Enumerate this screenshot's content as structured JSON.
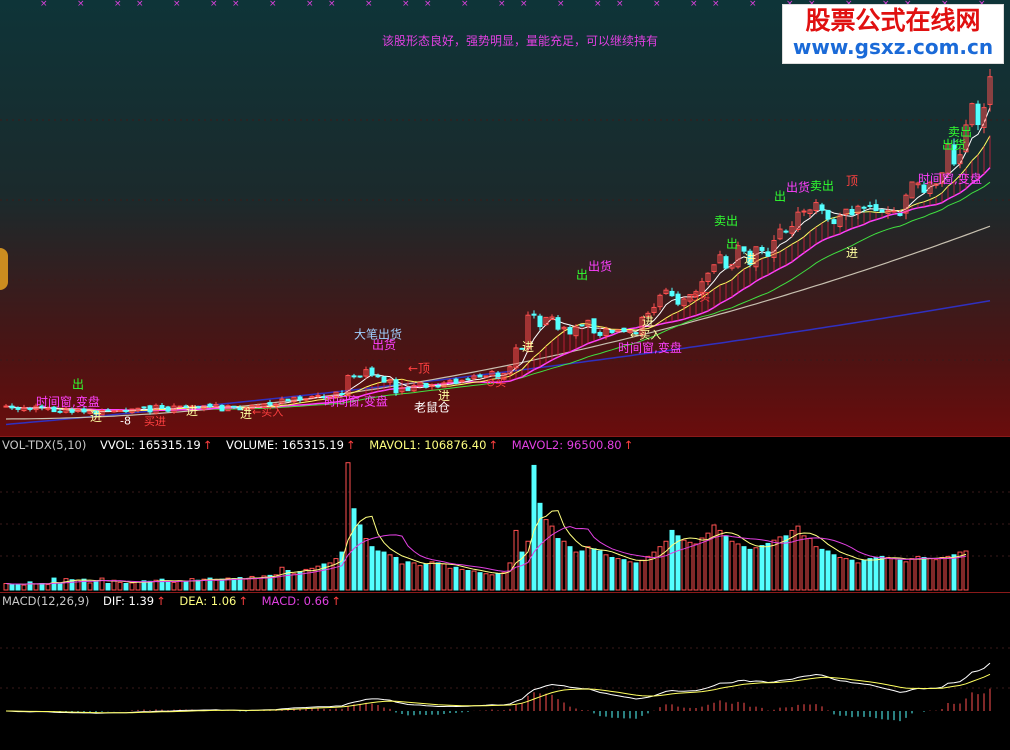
{
  "note": "该股形态良好，强势明显，量能充足，可以继续持有",
  "watermark": {
    "line1": "股票公式在线网",
    "line2": "www.gsxz.com.cn"
  },
  "volume_panel": {
    "indicator": "VOL-TDX(5,10)",
    "vvol": "VVOL: 165315.19",
    "volume": "VOLUME: 165315.19",
    "mavol1": "MAVOL1: 106876.40",
    "mavol2": "MAVOL2: 96500.80"
  },
  "macd_panel": {
    "indicator": "MACD(12,26,9)",
    "dif": "DIF: 1.39",
    "dea": "DEA: 1.06",
    "macd": "MACD: 0.66"
  },
  "colors": {
    "up": "#ff5050",
    "down": "#54ffff",
    "ma5": "#ffffff",
    "ma10": "#ffff60",
    "ma20": "#ff40ff",
    "ma30": "#40e040",
    "ma60": "#c8c0b0",
    "ma120": "#3030c0",
    "mavol2": "#e040e0"
  },
  "chart_data": [
    {
      "type": "candlestick",
      "x": [
        1,
        2,
        3,
        4,
        5,
        6,
        7,
        8,
        9,
        10,
        11,
        12,
        13,
        14,
        15,
        16,
        17,
        18,
        19,
        20,
        21,
        22,
        23,
        24,
        25,
        26,
        27,
        28,
        29,
        30,
        31,
        32,
        33,
        34,
        35,
        36,
        37,
        38,
        39,
        40,
        41,
        42,
        43,
        44,
        45,
        46,
        47,
        48,
        49,
        50,
        51,
        52,
        53,
        54,
        55,
        56,
        57,
        58,
        59,
        60,
        61,
        62,
        63,
        64,
        65,
        66,
        67,
        68,
        69,
        70,
        71,
        72,
        73,
        74,
        75,
        76,
        77,
        78,
        79,
        80,
        81,
        82,
        83,
        84,
        85,
        86,
        87,
        88,
        89,
        90,
        91,
        92,
        93,
        94,
        95,
        96,
        97,
        98,
        99,
        100,
        101,
        102,
        103,
        104,
        105,
        106,
        107,
        108,
        109,
        110,
        111,
        112,
        113,
        114,
        115,
        116,
        117,
        118,
        119,
        120,
        121,
        122,
        123,
        124,
        125,
        126,
        127,
        128,
        129,
        130,
        131,
        132,
        133,
        134,
        135,
        136,
        137,
        138,
        139,
        140,
        141,
        142,
        143,
        144,
        145,
        146,
        147,
        148,
        149,
        150,
        151,
        152,
        153,
        154,
        155,
        156,
        157,
        158,
        159,
        160,
        161
      ],
      "close": [
        5.55,
        5.5,
        5.46,
        5.51,
        5.46,
        5.55,
        5.52,
        5.49,
        5.4,
        5.39,
        5.47,
        5.38,
        5.46,
        5.39,
        5.41,
        5.33,
        5.43,
        5.44,
        5.42,
        5.43,
        5.4,
        5.47,
        5.49,
        5.52,
        5.39,
        5.57,
        5.49,
        5.41,
        5.55,
        5.55,
        5.52,
        5.55,
        5.5,
        5.56,
        5.54,
        5.59,
        5.42,
        5.56,
        5.53,
        5.45,
        5.49,
        5.57,
        5.56,
        5.61,
        5.59,
        5.6,
        5.74,
        5.69,
        5.79,
        5.72,
        5.75,
        5.81,
        5.84,
        5.78,
        5.81,
        5.93,
        5.88,
        6.38,
        6.35,
        6.35,
        6.54,
        6.39,
        6.35,
        6.2,
        6.27,
        5.91,
        6.05,
        5.97,
        6.11,
        6.19,
        6.06,
        6.13,
        6.09,
        6.18,
        6.25,
        6.17,
        6.25,
        6.27,
        6.37,
        6.34,
        6.37,
        6.49,
        6.3,
        6.44,
        6.62,
        7.13,
        7.1,
        8.02,
        8.02,
        7.71,
        7.96,
        7.97,
        7.64,
        7.69,
        7.51,
        7.7,
        7.73,
        7.88,
        7.54,
        7.47,
        7.65,
        7.55,
        7.62,
        7.58,
        7.6,
        7.54,
        7.96,
        8.07,
        8.23,
        8.56,
        8.7,
        8.55,
        8.32,
        8.46,
        8.58,
        8.66,
        8.93,
        9.16,
        9.39,
        9.66,
        9.3,
        9.4,
        9.91,
        9.76,
        9.4,
        9.88,
        9.78,
        9.62,
        10.05,
        10.36,
        10.3,
        10.43,
        10.82,
        10.85,
        10.88,
        11.08,
        10.87,
        10.63,
        10.51,
        10.72,
        10.9,
        10.75,
        10.98,
        10.93,
        10.99,
        10.86,
        10.82,
        10.86,
        10.85,
        10.73,
        11.28,
        11.64,
        11.61,
        11.36,
        11.63,
        11.59,
        11.89,
        12.67,
        12.13,
        12.38,
        13.19,
        13.77,
        13.2,
        13.66,
        14.5
      ]
    },
    {
      "type": "bar",
      "name": "VOLUME",
      "x": [
        1,
        2,
        3,
        4,
        5,
        6,
        7,
        8,
        9,
        10,
        11,
        12,
        13,
        14,
        15,
        16,
        17,
        18,
        19,
        20,
        21,
        22,
        23,
        24,
        25,
        26,
        27,
        28,
        29,
        30,
        31,
        32,
        33,
        34,
        35,
        36,
        37,
        38,
        39,
        40,
        41,
        42,
        43,
        44,
        45,
        46,
        47,
        48,
        49,
        50,
        51,
        52,
        53,
        54,
        55,
        56,
        57,
        58,
        59,
        60,
        61,
        62,
        63,
        64,
        65,
        66,
        67,
        68,
        69,
        70,
        71,
        72,
        73,
        74,
        75,
        76,
        77,
        78,
        79,
        80,
        81,
        82,
        83,
        84,
        85,
        86,
        87,
        88,
        89,
        90,
        91,
        92,
        93,
        94,
        95,
        96,
        97,
        98,
        99,
        100,
        101,
        102,
        103,
        104,
        105,
        106,
        107,
        108,
        109,
        110,
        111,
        112,
        113,
        114,
        115,
        116,
        117,
        118,
        119,
        120,
        121,
        122,
        123,
        124,
        125,
        126,
        127,
        128,
        129,
        130,
        131,
        132,
        133,
        134,
        135,
        136,
        137,
        138,
        139,
        140,
        141,
        142,
        143,
        144,
        145,
        146,
        147,
        148,
        149,
        150,
        151,
        152,
        153,
        154,
        155,
        156,
        157,
        158,
        159,
        160,
        161
      ],
      "values": [
        12000,
        10000,
        11000,
        9000,
        15000,
        11000,
        12000,
        10000,
        22000,
        12000,
        21000,
        19000,
        18000,
        20000,
        13000,
        17000,
        22000,
        12000,
        18000,
        14000,
        12000,
        13000,
        15000,
        17000,
        16000,
        18000,
        20000,
        16000,
        14000,
        17000,
        15000,
        21000,
        18000,
        20000,
        22000,
        18000,
        20000,
        22000,
        21000,
        23000,
        20000,
        25000,
        22000,
        26000,
        27000,
        28000,
        42000,
        36000,
        30000,
        34000,
        38000,
        40000,
        44000,
        48000,
        50000,
        58000,
        70000,
        235000,
        150000,
        120000,
        95000,
        80000,
        72000,
        70000,
        65000,
        60000,
        48000,
        52000,
        50000,
        45000,
        48000,
        52000,
        50000,
        48000,
        40000,
        42000,
        38000,
        36000,
        35000,
        32000,
        30000,
        28000,
        30000,
        32000,
        50000,
        110000,
        70000,
        90000,
        230000,
        160000,
        130000,
        118000,
        95000,
        90000,
        80000,
        70000,
        72000,
        80000,
        76000,
        72000,
        65000,
        60000,
        58000,
        56000,
        52000,
        50000,
        55000,
        62000,
        70000,
        80000,
        90000,
        110000,
        100000,
        92000,
        88000,
        85000,
        96000,
        105000,
        120000,
        110000,
        100000,
        90000,
        85000,
        80000,
        75000,
        78000,
        82000,
        86000,
        92000,
        98000,
        100000,
        110000,
        118000,
        100000,
        95000,
        80000,
        75000,
        72000,
        65000,
        60000,
        58000,
        55000,
        50000,
        55000,
        58000,
        60000,
        62000,
        60000,
        58000,
        55000,
        52000,
        58000,
        62000,
        60000,
        58000,
        56000,
        60000,
        62000,
        65000,
        70000,
        72000
      ]
    },
    {
      "type": "line",
      "name": "MACD",
      "series": [
        {
          "name": "DIF"
        },
        {
          "name": "DEA"
        },
        {
          "name": "MACD"
        }
      ]
    }
  ],
  "annotations": {
    "chu": "出",
    "chu_huo": "出货",
    "jin": "进",
    "mai_chu": "卖出",
    "ding": "顶",
    "arrow_ding": "←顶",
    "da_bi_chu_huo": "大笔出货",
    "shi_jian_chuang": "时间窗,变盘",
    "shi_jian_chuang2": "时间窗,变盘",
    "lao_shu_cang": "老鼠仓",
    "mai_r": "←买入",
    "yi_mai": "⊙买",
    "dollar": "$",
    "mai_jin": "买进",
    "neg8": "-8"
  }
}
